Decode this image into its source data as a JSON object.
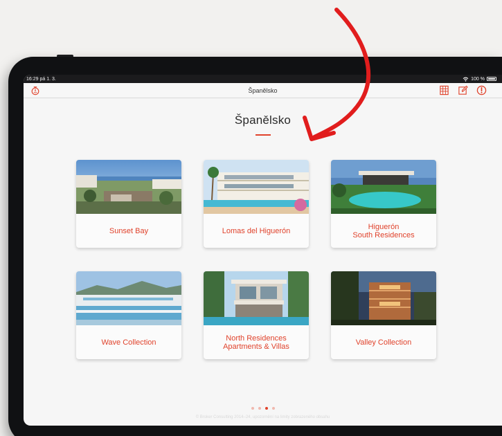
{
  "statusbar": {
    "time": "16:29",
    "date": "pá 1. 3.",
    "battery": "100 %"
  },
  "navbar": {
    "title": "Španělsko"
  },
  "page": {
    "heading": "Španělsko"
  },
  "cards": [
    {
      "label": "Sunset Bay"
    },
    {
      "label": "Lomas del Higuerón"
    },
    {
      "label": "Higuerón\nSouth Residences"
    },
    {
      "label": "Wave Collection"
    },
    {
      "label": "North Residences\nApartments & Villas"
    },
    {
      "label": "Valley Collection"
    }
  ],
  "pager": {
    "count": 4,
    "active": 2
  },
  "footer": {
    "text": "© Broker Consulting 2014–24, upozornění na limity zobrazeného obsahu"
  },
  "colors": {
    "accent": "#e0422b",
    "annotation_arrow": "#e11d1d"
  },
  "icons": [
    "timer-icon",
    "grid-icon",
    "edit-icon",
    "alert-icon",
    "wifi-icon",
    "battery-icon"
  ]
}
